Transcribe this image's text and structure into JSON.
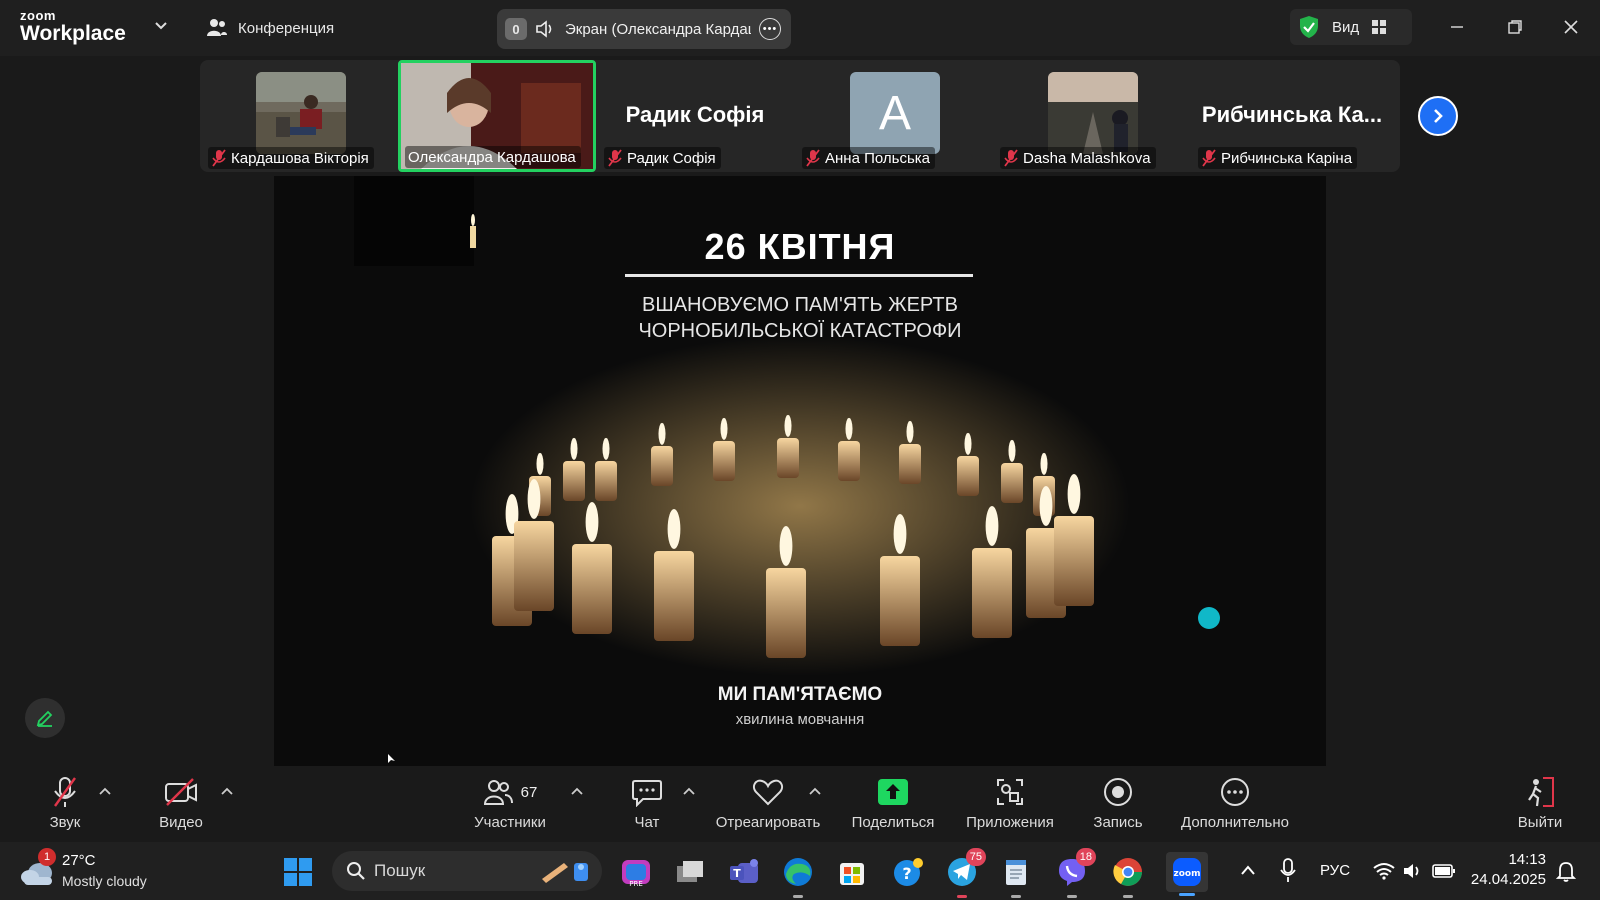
{
  "titlebar": {
    "logo_top": "zoom",
    "logo_bottom": "Workplace",
    "meeting_label": "Конференция",
    "screen_badge": "0",
    "screen_label": "Экран (Олександра Кардашова)",
    "view_label": "Вид",
    "icons": [
      "chevron-down-icon",
      "people-icon",
      "speaker-icon",
      "more-icon",
      "shield-check-icon",
      "grid-icon",
      "minimize-icon",
      "restore-icon",
      "close-icon"
    ]
  },
  "gallery": {
    "participants": [
      {
        "name": "Кардашова Вікторія",
        "type": "video",
        "muted": true
      },
      {
        "name": "Олександра Кардашова",
        "type": "video",
        "muted": false,
        "active": true
      },
      {
        "name": "Радик Софія",
        "display_name": "Радик Софія",
        "type": "name",
        "muted": true
      },
      {
        "name": "Анна Польська",
        "initial": "A",
        "type": "avatar",
        "muted": true
      },
      {
        "name": "Dasha Malashkova",
        "type": "video",
        "muted": true
      },
      {
        "name": "Рибчинська Каріна",
        "display_name": "Рибчинська Ка...",
        "type": "name",
        "muted": true
      }
    ]
  },
  "slide": {
    "title": "26 КВІТНЯ",
    "subtitle_line1": "ВШАНОВУЄМО ПАМ'ЯТЬ ЖЕРТВ",
    "subtitle_line2": "ЧОРНОБИЛЬСЬКОЇ КАТАСТРОФИ",
    "footer_line1": "МИ ПАМ'ЯТАЄМО",
    "footer_line2": "хвилина мовчання"
  },
  "toolbar": {
    "audio": "Звук",
    "video": "Видео",
    "participants": "Участники",
    "participants_count": "67",
    "chat": "Чат",
    "react": "Отреагировать",
    "share": "Поделиться",
    "apps": "Приложения",
    "record": "Запись",
    "more": "Дополнительно",
    "leave": "Выйти"
  },
  "taskbar": {
    "weather_badge": "1",
    "temperature": "27°C",
    "condition": "Mostly cloudy",
    "search_placeholder": "Пошук",
    "telegram_badge": "75",
    "viber_badge": "18",
    "language": "РУС",
    "time": "14:13",
    "date": "24.04.2025"
  },
  "colors": {
    "accent_green": "#23d160",
    "zoom_blue": "#1e6ff5",
    "share_green": "#1ed760",
    "mute_red": "#e0364a"
  }
}
